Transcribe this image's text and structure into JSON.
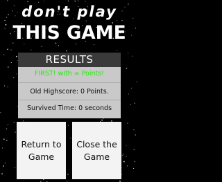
{
  "title": {
    "line1": "don't play",
    "line2": "THIS GAME"
  },
  "results": {
    "header": "RESULTS",
    "first_line": "FIRST! with ∞ Points!",
    "highscore_line": "Old Highscore: 0 Points.",
    "survived_line": "Survived Time: 0 seconds"
  },
  "buttons": {
    "return_label": "Return to\nGame",
    "close_label": "Close the\nGame"
  },
  "colors": {
    "background": "#000000",
    "panel": "#c9c9c9",
    "panel_header": "#3a3a3a",
    "accent_green": "#27e60e",
    "button": "#f3f3f3"
  }
}
